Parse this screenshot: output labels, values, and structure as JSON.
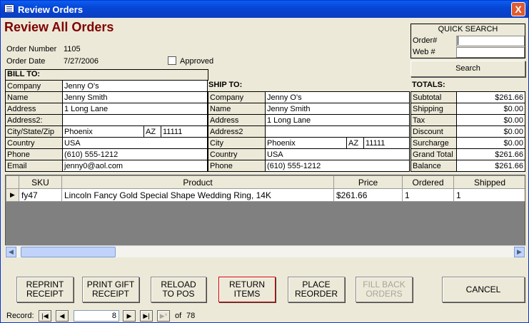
{
  "window": {
    "title": "Review Orders",
    "close_label": "X"
  },
  "heading": "Review All Orders",
  "order": {
    "number_label": "Order Number",
    "number": "1105",
    "date_label": "Order Date",
    "date": "7/27/2006",
    "approved_label": "Approved",
    "approved": false
  },
  "quick_search": {
    "title": "QUICK SEARCH",
    "order_label": "Order#",
    "order_value": "",
    "web_label": "Web #",
    "web_value": "",
    "search_label": "Search"
  },
  "bill_to": {
    "header": "BILL TO:",
    "company_label": "Company",
    "company": "Jenny O's",
    "name_label": "Name",
    "name": "Jenny Smith",
    "address_label": "Address",
    "address": "1 Long Lane",
    "address2_label": "Address2:",
    "address2": "",
    "csz_label": "City/State/Zip",
    "city": "Phoenix",
    "state": "AZ",
    "zip": "11111",
    "country_label": "Country",
    "country": "USA",
    "phone_label": "Phone",
    "phone": "(610) 555-1212",
    "email_label": "Email",
    "email": "jenny0@aol.com"
  },
  "ship_to": {
    "header": "SHIP TO:",
    "company_label": "Company",
    "company": "Jenny O's",
    "name_label": "Name",
    "name": "Jenny Smith",
    "address_label": "Address",
    "address": "1 Long Lane",
    "address2_label": "Address2",
    "address2": "",
    "city_label": "City",
    "city": "Phoenix",
    "state": "AZ",
    "zip": "11111",
    "country_label": "Country",
    "country": "USA",
    "phone_label": "Phone",
    "phone": "(610) 555-1212"
  },
  "totals": {
    "header": "TOTALS:",
    "subtotal_label": "Subtotal",
    "subtotal": "$261.66",
    "shipping_label": "Shipping",
    "shipping": "$0.00",
    "tax_label": "Tax",
    "tax": "$0.00",
    "discount_label": "Discount",
    "discount": "$0.00",
    "surcharge_label": "Surcharge",
    "surcharge": "$0.00",
    "grand_total_label": "Grand Total",
    "grand_total": "$261.66",
    "balance_label": "Balance",
    "balance": "$261.66"
  },
  "items": {
    "columns": [
      "SKU",
      "Product",
      "Price",
      "Ordered",
      "Shipped"
    ],
    "rows": [
      {
        "sku": "fy47",
        "product": "Lincoln Fancy Gold Special Shape Wedding Ring, 14K",
        "price": "$261.66",
        "ordered": "1",
        "shipped": "1"
      }
    ]
  },
  "buttons": {
    "reprint_1": "REPRINT",
    "reprint_2": "RECEIPT",
    "gift_1": "PRINT GIFT",
    "gift_2": "RECEIPT",
    "reload_1": "RELOAD",
    "reload_2": "TO POS",
    "return_1": "RETURN",
    "return_2": "ITEMS",
    "reorder_1": "PLACE",
    "reorder_2": "REORDER",
    "fillback_1": "FILL BACK",
    "fillback_2": "ORDERS",
    "cancel": "CANCEL"
  },
  "record_nav": {
    "label": "Record:",
    "current": "8",
    "of_label": "of",
    "total": "78"
  }
}
